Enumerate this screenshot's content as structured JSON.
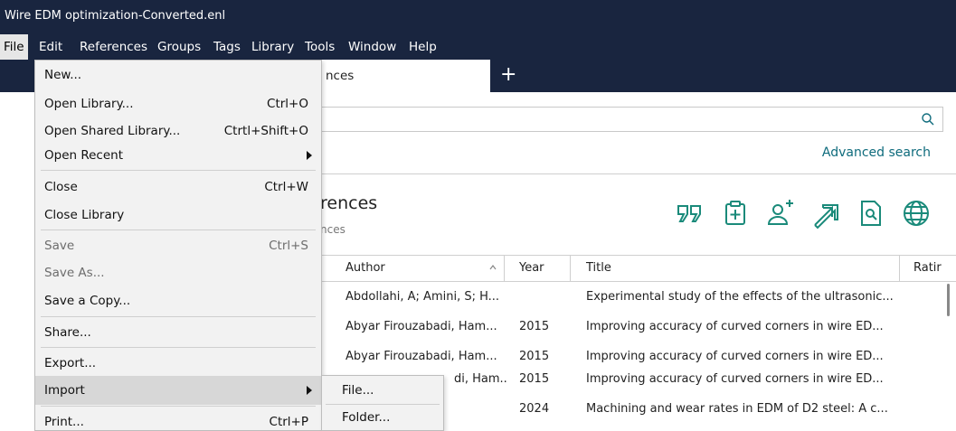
{
  "window": {
    "title": "Wire EDM optimization-Converted.enl"
  },
  "menubar": [
    "File",
    "Edit",
    "References",
    "Groups",
    "Tags",
    "Library",
    "Tools",
    "Window",
    "Help"
  ],
  "tab": {
    "label": "nces",
    "add_label": "+"
  },
  "search": {
    "advanced_label": "Advanced search"
  },
  "group": {
    "title": "rences",
    "subtitle": "nces"
  },
  "table": {
    "headers": {
      "author": "Author",
      "year": "Year",
      "title": "Title",
      "rating": "Ratir"
    },
    "rows": [
      {
        "author": "Abdollahi, A; Amini, S; H...",
        "year": "",
        "title": "Experimental study of the effects of the ultrasonic..."
      },
      {
        "author": "Abyar Firouzabadi, Ham...",
        "year": "2015",
        "title": "Improving accuracy of curved corners in wire ED..."
      },
      {
        "author": "Abyar Firouzabadi, Ham...",
        "year": "2015",
        "title": "Improving accuracy of curved corners in wire ED..."
      },
      {
        "author": "di, Ham...",
        "year": "2015",
        "title": "Improving accuracy of curved corners in wire ED..."
      },
      {
        "author": "",
        "year": "2024",
        "title": "Machining and wear rates in EDM of D2 steel: A c..."
      }
    ]
  },
  "file_menu": {
    "items": [
      {
        "label": "New...",
        "shortcut": ""
      },
      {
        "label": "Open Library...",
        "shortcut": "Ctrl+O"
      },
      {
        "label": "Open Shared Library...",
        "shortcut": "Ctrtl+Shift+O"
      },
      {
        "label": "Open Recent",
        "shortcut": ""
      },
      {
        "label": "Close",
        "shortcut": "Ctrl+W"
      },
      {
        "label": "Close Library",
        "shortcut": ""
      },
      {
        "label": "Save",
        "shortcut": "Ctrl+S"
      },
      {
        "label": "Save As...",
        "shortcut": ""
      },
      {
        "label": "Save a Copy...",
        "shortcut": ""
      },
      {
        "label": "Share...",
        "shortcut": ""
      },
      {
        "label": "Export...",
        "shortcut": ""
      },
      {
        "label": "Import",
        "shortcut": ""
      },
      {
        "label": "Print...",
        "shortcut": "Ctrl+P"
      }
    ]
  },
  "import_submenu": [
    "File...",
    "Folder..."
  ],
  "colors": {
    "titlebar": "#19253f",
    "accent": "#0e6b7c",
    "icon": "#1a8a7a"
  }
}
